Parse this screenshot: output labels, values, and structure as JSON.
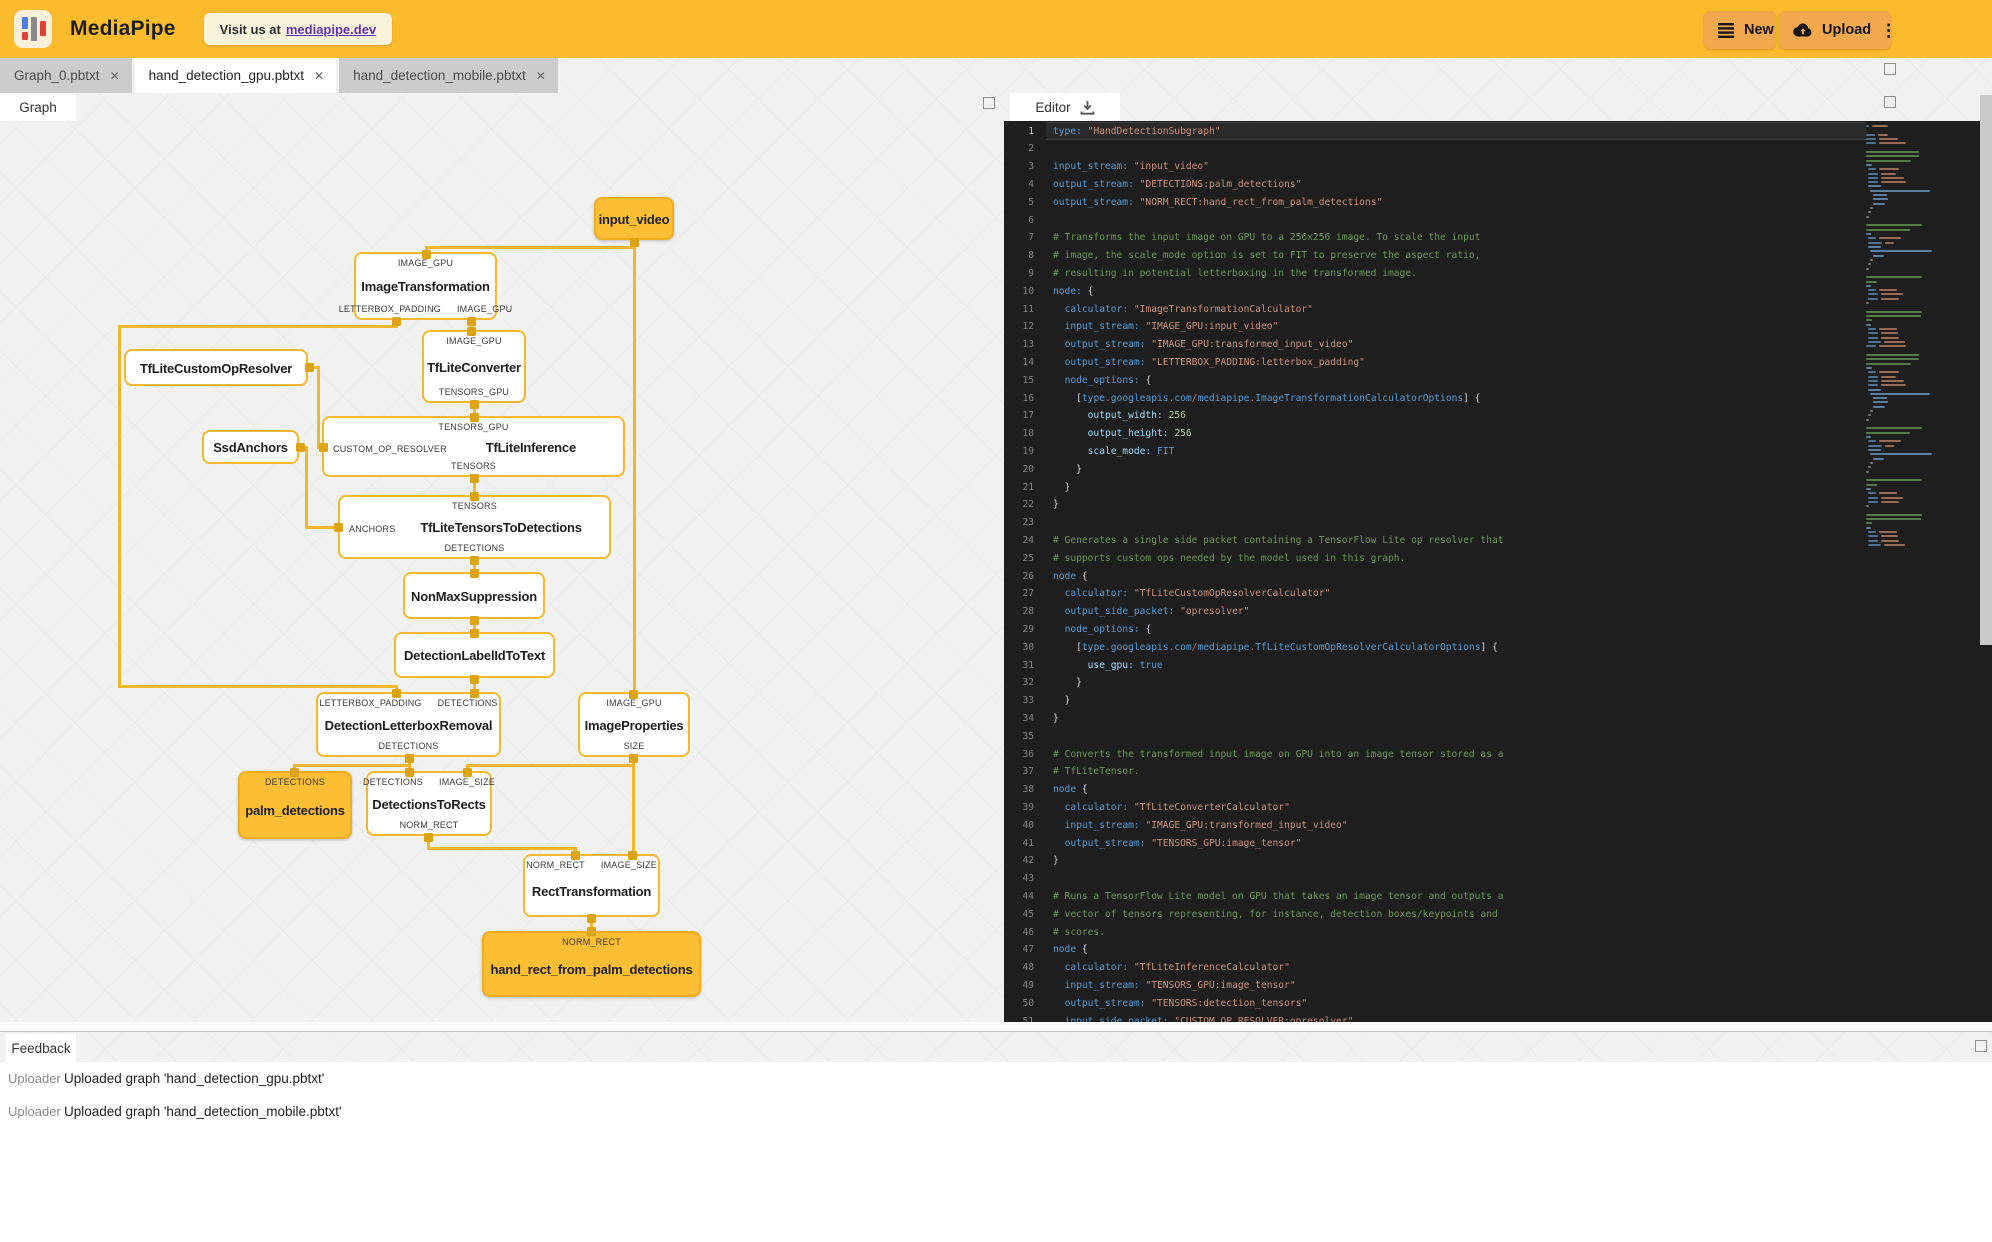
{
  "header": {
    "brand": "MediaPipe",
    "visit_prefix": "Visit us at",
    "visit_link": "mediapipe.dev",
    "new_label": "New",
    "upload_label": "Upload"
  },
  "file_tabs": [
    {
      "label": "Graph_0.pbtxt",
      "active": false,
      "close": "✕"
    },
    {
      "label": "hand_detection_gpu.pbtxt",
      "active": true,
      "close": "✕"
    },
    {
      "label": "hand_detection_mobile.pbtxt",
      "active": false,
      "close": "✕"
    }
  ],
  "graph_panel": {
    "tab_label": "Graph"
  },
  "editor_panel": {
    "tab_label": "Editor"
  },
  "feedback": {
    "tab_label": "Feedback",
    "rows": [
      {
        "source": "Uploader",
        "message": "Uploaded graph 'hand_detection_gpu.pbtxt'"
      },
      {
        "source": "Uploader",
        "message": "Uploaded graph 'hand_detection_mobile.pbtxt'"
      }
    ]
  },
  "colors": {
    "header_bg": "#FBBB2C",
    "button_bg": "#F3A84D",
    "stream_node_bg": "#FCBE35",
    "node_border": "#F5B82E",
    "edge": "#F2B72B",
    "port_square": "#DCA312",
    "editor_bg": "#1E1E1E",
    "link": "#5E35B1"
  },
  "graph": {
    "nodes": [
      {
        "id": "input_video",
        "title": "input_video",
        "kind": "stream",
        "top_label": ""
      },
      {
        "id": "ImageTransformation",
        "title": "ImageTransformation",
        "kind": "calc",
        "top_ports": [
          "IMAGE_GPU"
        ],
        "bottom_ports": [
          "LETTERBOX_PADDING",
          "IMAGE_GPU"
        ]
      },
      {
        "id": "TfLiteConverter",
        "title": "TfLiteConverter",
        "kind": "calc",
        "top_ports": [
          "IMAGE_GPU"
        ],
        "bottom_ports": [
          "TENSORS_GPU"
        ]
      },
      {
        "id": "TfLiteCustomOpResolver",
        "title": "TfLiteCustomOpResolver",
        "kind": "calc"
      },
      {
        "id": "SsdAnchors",
        "title": "SsdAnchors",
        "kind": "calc"
      },
      {
        "id": "TfLiteInference",
        "title": "TfLiteInference",
        "kind": "calc",
        "top_ports": [
          "TENSORS_GPU"
        ],
        "bottom_ports": [
          "TENSORS"
        ],
        "left_port": "CUSTOM_OP_RESOLVER"
      },
      {
        "id": "TfLiteTensorsToDetections",
        "title": "TfLiteTensorsToDetections",
        "kind": "calc",
        "top_ports": [
          "TENSORS"
        ],
        "bottom_ports": [
          "DETECTIONS"
        ],
        "left_port": "ANCHORS"
      },
      {
        "id": "NonMaxSuppression",
        "title": "NonMaxSuppression",
        "kind": "calc"
      },
      {
        "id": "DetectionLabelIdToText",
        "title": "DetectionLabelIdToText",
        "kind": "calc"
      },
      {
        "id": "DetectionLetterboxRemoval",
        "title": "DetectionLetterboxRemoval",
        "kind": "calc",
        "top_ports": [
          "LETTERBOX_PADDING",
          "DETECTIONS"
        ],
        "bottom_ports": [
          "DETECTIONS"
        ]
      },
      {
        "id": "ImageProperties",
        "title": "ImageProperties",
        "kind": "calc",
        "top_ports": [
          "IMAGE_GPU"
        ],
        "bottom_ports": [
          "SIZE"
        ]
      },
      {
        "id": "palm_detections",
        "title": "palm_detections",
        "kind": "stream",
        "top_label": "DETECTIONS"
      },
      {
        "id": "DetectionsToRects",
        "title": "DetectionsToRects",
        "kind": "calc",
        "top_ports": [
          "DETECTIONS",
          "IMAGE_SIZE"
        ],
        "bottom_ports": [
          "NORM_RECT"
        ]
      },
      {
        "id": "RectTransformation",
        "title": "RectTransformation",
        "kind": "calc",
        "top_ports": [
          "NORM_RECT",
          "IMAGE_SIZE"
        ]
      },
      {
        "id": "hand_rect_from_palm_detections",
        "title": "hand_rect_from_palm_detections",
        "kind": "stream",
        "top_label": "NORM_RECT"
      }
    ]
  },
  "code": {
    "lines": [
      "type: \"HandDetectionSubgraph\"",
      "",
      "input_stream: \"input_video\"",
      "output_stream: \"DETECTIONS:palm_detections\"",
      "output_stream: \"NORM_RECT:hand_rect_from_palm_detections\"",
      "",
      "# Transforms the input image on GPU to a 256x256 image. To scale the input",
      "# image, the scale_mode option is set to FIT to preserve the aspect ratio,",
      "# resulting in potential letterboxing in the transformed image.",
      "node: {",
      "  calculator: \"ImageTransformationCalculator\"",
      "  input_stream: \"IMAGE_GPU:input_video\"",
      "  output_stream: \"IMAGE_GPU:transformed_input_video\"",
      "  output_stream: \"LETTERBOX_PADDING:letterbox_padding\"",
      "  node_options: {",
      "    [type.googleapis.com/mediapipe.ImageTransformationCalculatorOptions] {",
      "      output_width: 256",
      "      output_height: 256",
      "      scale_mode: FIT",
      "    }",
      "  }",
      "}",
      "",
      "# Generates a single side packet containing a TensorFlow Lite op resolver that",
      "# supports custom ops needed by the model used in this graph.",
      "node {",
      "  calculator: \"TfLiteCustomOpResolverCalculator\"",
      "  output_side_packet: \"opresolver\"",
      "  node_options: {",
      "    [type.googleapis.com/mediapipe.TfLiteCustomOpResolverCalculatorOptions] {",
      "      use_gpu: true",
      "    }",
      "  }",
      "}",
      "",
      "# Converts the transformed input image on GPU into an image tensor stored as a",
      "# TfLiteTensor.",
      "node {",
      "  calculator: \"TfLiteConverterCalculator\"",
      "  input_stream: \"IMAGE_GPU:transformed_input_video\"",
      "  output_stream: \"TENSORS_GPU:image_tensor\"",
      "}",
      "",
      "# Runs a TensorFlow Lite model on GPU that takes an image tensor and outputs a",
      "# vector of tensors representing, for instance, detection boxes/keypoints and",
      "# scores.",
      "node {",
      "  calculator: \"TfLiteInferenceCalculator\"",
      "  input_stream: \"TENSORS_GPU:image_tensor\"",
      "  output_stream: \"TENSORS:detection_tensors\"",
      "  input_side_packet: \"CUSTOM_OP_RESOLVER:opresolver\""
    ]
  }
}
